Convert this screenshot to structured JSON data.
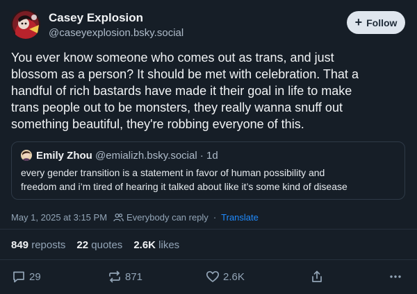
{
  "author": {
    "name": "Casey Explosion",
    "handle": "@caseyexplosion.bsky.social"
  },
  "follow_label": "Follow",
  "post_text": "You ever know someone who comes out as trans, and just\nblossom as a person? It should be met with celebration. That a\nhandful of rich bastards have made it their goal in life to make\ntrans people out to be monsters, they really wanna snuff out\nsomething beautiful, they're robbing everyone of this.",
  "quote": {
    "author_name": "Emily Zhou",
    "author_handle": "@emializh.bsky.social",
    "separator": "·",
    "time_ago": "1d",
    "text": "every gender transition is a statement in favor of human possibility and\nfreedom and i’m tired of hearing it talked about like it’s some kind of disease"
  },
  "meta": {
    "timestamp": "May 1, 2025 at 3:15 PM",
    "audience": "Everybody can reply",
    "separator": "·",
    "translate_label": "Translate"
  },
  "stats": {
    "reposts_count": "849",
    "reposts_label": "reposts",
    "quotes_count": "22",
    "quotes_label": "quotes",
    "likes_count": "2.6K",
    "likes_label": "likes"
  },
  "actions": {
    "reply_count": "29",
    "repost_count": "871",
    "like_count": "2.6K"
  },
  "icons": {
    "follow": "plus-icon",
    "audience": "people-icon",
    "reply": "speech-bubble-icon",
    "repost": "repost-arrows-icon",
    "like": "heart-icon",
    "share": "share-up-icon",
    "more": "ellipsis-icon"
  },
  "colors": {
    "background": "#161e27",
    "text_primary": "#f1f3f5",
    "text_secondary": "#93a5b7",
    "link": "#208bfe",
    "follow_button_bg": "#dfe6ee"
  }
}
